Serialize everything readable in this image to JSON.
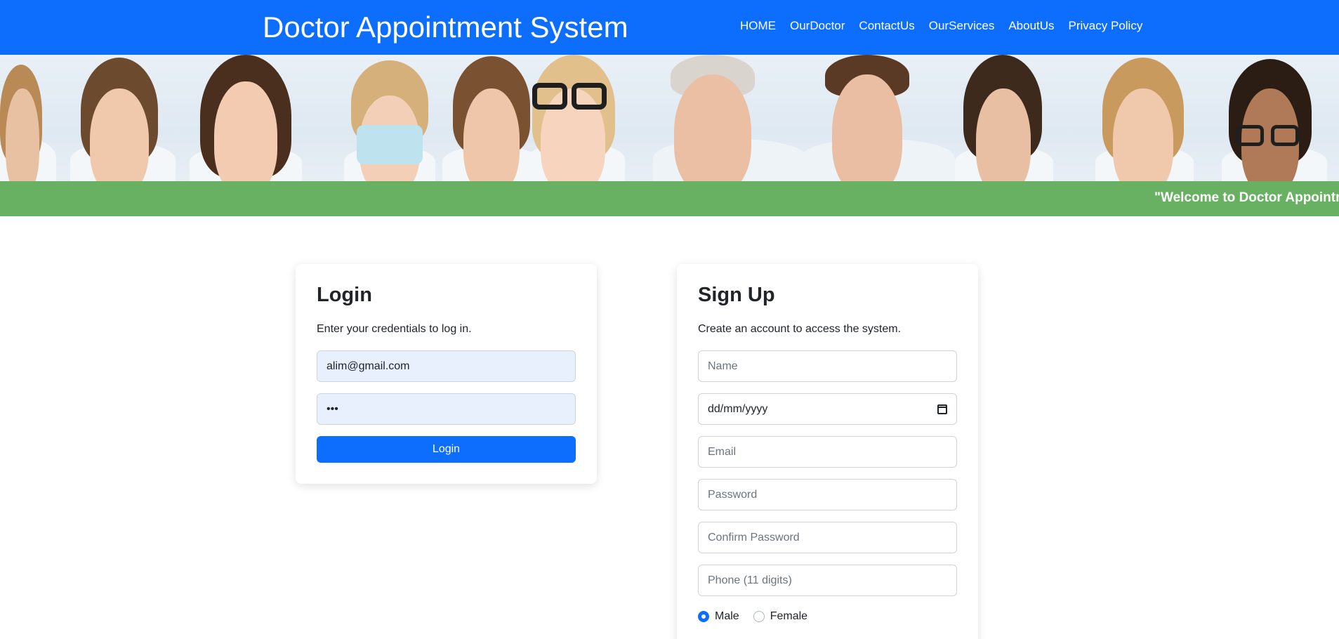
{
  "header": {
    "brand": "Doctor Appointment System",
    "nav": [
      "HOME",
      "OurDoctor",
      "ContactUs",
      "OurServices",
      "AboutUs",
      "Privacy Policy"
    ]
  },
  "ticker": {
    "text": "\"Welcome to Doctor Appointm"
  },
  "login": {
    "title": "Login",
    "subtitle": "Enter your credentials to log in.",
    "email_value": "alim@gmail.com",
    "password_value": "•••",
    "button_label": "Login"
  },
  "signup": {
    "title": "Sign Up",
    "subtitle": "Create an account to access the system.",
    "name_placeholder": "Name",
    "dob_placeholder": "dd/mm/yyyy",
    "email_placeholder": "Email",
    "password_placeholder": "Password",
    "confirm_placeholder": "Confirm Password",
    "phone_placeholder": "Phone (11 digits)",
    "gender": {
      "male": "Male",
      "female": "Female",
      "selected": "Male"
    }
  },
  "colors": {
    "primary": "#0d6efd",
    "ticker": "#68b162",
    "field_fill": "#e8f0fe"
  },
  "icons": {
    "date": "calendar-icon"
  }
}
